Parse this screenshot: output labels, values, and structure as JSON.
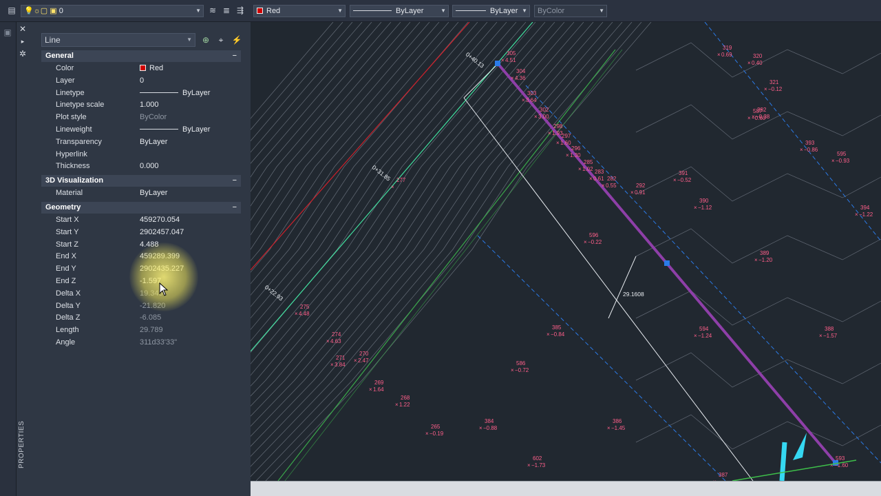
{
  "toolbar": {
    "layer_value": "0",
    "color_value": "Red",
    "linetype_value": "ByLayer",
    "lineweight_value": "ByLayer",
    "plotstyle_value": "ByColor"
  },
  "panel": {
    "vertical_title": "PROPERTIES",
    "selector_value": "Line",
    "sections": {
      "general": {
        "title": "General",
        "toggle": "−",
        "rows": [
          {
            "label": "Color",
            "value": "Red"
          },
          {
            "label": "Layer",
            "value": "0"
          },
          {
            "label": "Linetype",
            "value": "ByLayer"
          },
          {
            "label": "Linetype scale",
            "value": "1.000"
          },
          {
            "label": "Plot style",
            "value": "ByColor"
          },
          {
            "label": "Lineweight",
            "value": "ByLayer"
          },
          {
            "label": "Transparency",
            "value": "ByLayer"
          },
          {
            "label": "Hyperlink",
            "value": ""
          },
          {
            "label": "Thickness",
            "value": "0.000"
          }
        ]
      },
      "visualization": {
        "title": "3D Visualization",
        "toggle": "−",
        "rows": [
          {
            "label": "Material",
            "value": "ByLayer"
          }
        ]
      },
      "geometry": {
        "title": "Geometry",
        "toggle": "−",
        "rows": [
          {
            "label": "Start X",
            "value": "459270.054"
          },
          {
            "label": "Start Y",
            "value": "2902457.047"
          },
          {
            "label": "Start Z",
            "value": "4.488"
          },
          {
            "label": "End X",
            "value": "459289.399"
          },
          {
            "label": "End Y",
            "value": "2902435.227"
          },
          {
            "label": "End Z",
            "value": "-1.597"
          },
          {
            "label": "Delta X",
            "value": "19.345"
          },
          {
            "label": "Delta Y",
            "value": "-21.820"
          },
          {
            "label": "Delta Z",
            "value": "-6.085"
          },
          {
            "label": "Length",
            "value": "29.789"
          },
          {
            "label": "Angle",
            "value": "311d33'33\""
          }
        ]
      }
    }
  },
  "drawing": {
    "stations": [
      "0+40.13",
      "0+31.85",
      "0+22.93"
    ],
    "dimension": "29.1608",
    "points": [
      {
        "id": "305",
        "elev": "4.51"
      },
      {
        "id": "304",
        "elev": "4.36"
      },
      {
        "id": "303",
        "elev": "3.64"
      },
      {
        "id": "302",
        "elev": "3.00"
      },
      {
        "id": "298",
        "elev": "1.93"
      },
      {
        "id": "297",
        "elev": "1.60"
      },
      {
        "id": "296",
        "elev": "1.30"
      },
      {
        "id": "285",
        "elev": "1.02"
      },
      {
        "id": "283",
        "elev": "0.61"
      },
      {
        "id": "282",
        "elev": "0.55"
      },
      {
        "id": "292",
        "elev": "0.91"
      },
      {
        "id": "391",
        "elev": "−0.52"
      },
      {
        "id": "390",
        "elev": "−1.12"
      },
      {
        "id": "389",
        "elev": "−1.20"
      },
      {
        "id": "388",
        "elev": "−1.57"
      },
      {
        "id": "394",
        "elev": "−1.22"
      },
      {
        "id": "393",
        "elev": "−0.86"
      },
      {
        "id": "392",
        "elev": "−0.38"
      },
      {
        "id": "321",
        "elev": "−0.12"
      },
      {
        "id": "320",
        "elev": "0.40"
      },
      {
        "id": "319",
        "elev": "0.69"
      },
      {
        "id": "587",
        "elev": "−0.60"
      },
      {
        "id": "595",
        "elev": "−0.93"
      },
      {
        "id": "596",
        "elev": "−0.22"
      },
      {
        "id": "594",
        "elev": "−1.24"
      },
      {
        "id": "593",
        "elev": "−1.60"
      },
      {
        "id": "586",
        "elev": "−0.72"
      },
      {
        "id": "385",
        "elev": "−0.84"
      },
      {
        "id": "386",
        "elev": "−1.45"
      },
      {
        "id": "384",
        "elev": "−0.88"
      },
      {
        "id": "602",
        "elev": "−1.73"
      },
      {
        "id": "387",
        "elev": ""
      },
      {
        "id": "277",
        "elev": ""
      },
      {
        "id": "275",
        "elev": "4.48"
      },
      {
        "id": "274",
        "elev": "4.63"
      },
      {
        "id": "271",
        "elev": "3.84"
      },
      {
        "id": "270",
        "elev": "2.47"
      },
      {
        "id": "269",
        "elev": "1.64"
      },
      {
        "id": "268",
        "elev": "1.22"
      },
      {
        "id": "265",
        "elev": "−0.19"
      }
    ]
  },
  "colors": {
    "canvas": "#212830",
    "selected_line": "#8e3fa8",
    "contour": "#7d8591",
    "point_label": "#ff5f8a",
    "grip": "#2b7be8"
  }
}
